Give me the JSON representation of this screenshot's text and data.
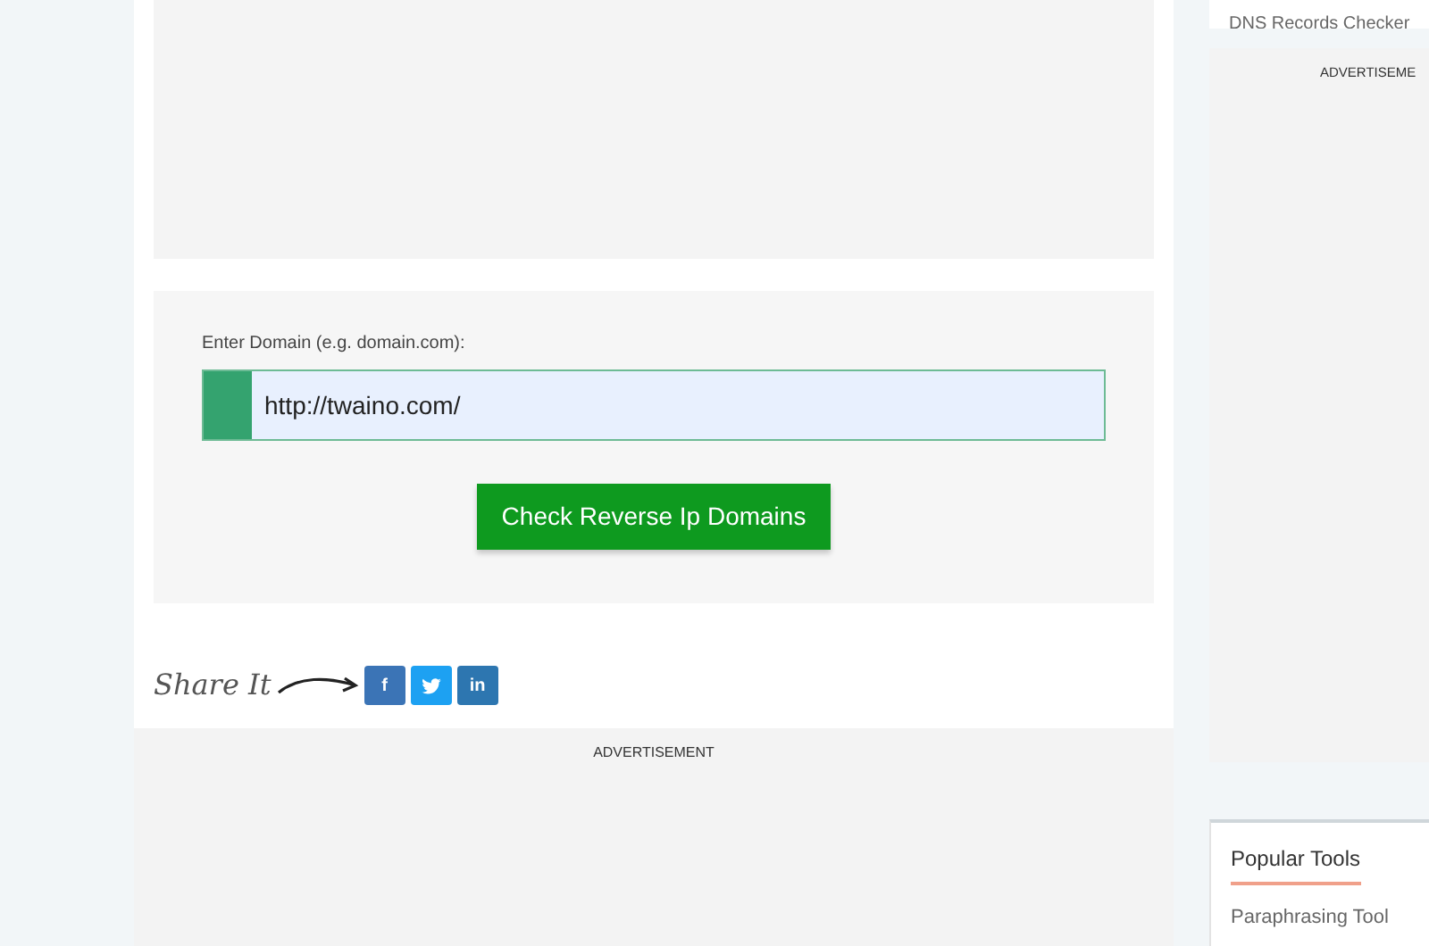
{
  "main": {
    "form": {
      "label": "Enter Domain (e.g. domain.com):",
      "value": "http://twaino.com/",
      "button": "Check Reverse Ip Domains"
    },
    "share": {
      "label": "Share It",
      "buttons": [
        {
          "kind": "facebook",
          "text": "f"
        },
        {
          "kind": "twitter"
        },
        {
          "kind": "linkedin",
          "text": "in"
        }
      ]
    },
    "advertisement": "ADVERTISEMENT"
  },
  "sidebar": {
    "top_link": "DNS Records Checker",
    "advertisement": "ADVERTISEME",
    "popular_tools": {
      "title": "Popular Tools",
      "items": [
        "Paraphrasing Tool"
      ]
    }
  }
}
